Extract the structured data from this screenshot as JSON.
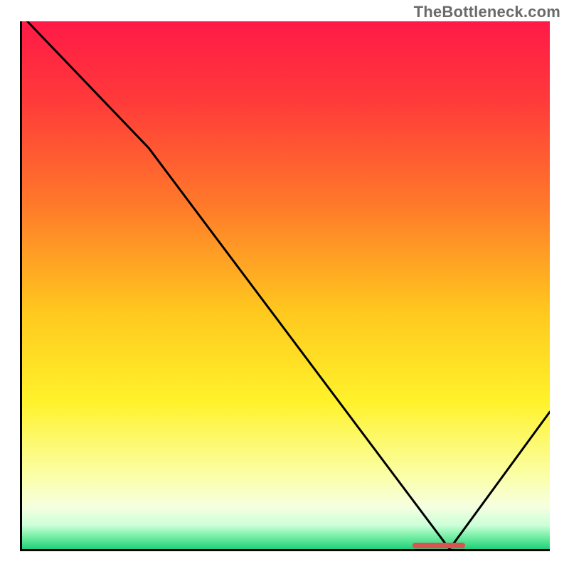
{
  "watermark": "TheBottleneck.com",
  "colors": {
    "axis": "#000000",
    "line": "#000000",
    "marker": "#d9534f",
    "gradient_stops": [
      {
        "offset": 0.0,
        "color": "#ff1a47"
      },
      {
        "offset": 0.15,
        "color": "#ff3a3a"
      },
      {
        "offset": 0.35,
        "color": "#ff7a2a"
      },
      {
        "offset": 0.55,
        "color": "#ffc81e"
      },
      {
        "offset": 0.72,
        "color": "#fff22a"
      },
      {
        "offset": 0.86,
        "color": "#fbffa6"
      },
      {
        "offset": 0.92,
        "color": "#f6ffe0"
      },
      {
        "offset": 0.955,
        "color": "#ccffd8"
      },
      {
        "offset": 0.975,
        "color": "#7af0a8"
      },
      {
        "offset": 1.0,
        "color": "#1fd07a"
      }
    ]
  },
  "chart_data": {
    "type": "line",
    "title": "",
    "xlabel": "",
    "ylabel": "",
    "xlim": [
      0,
      100
    ],
    "ylim": [
      0,
      100
    ],
    "x": [
      1,
      24,
      81,
      100
    ],
    "values": [
      100,
      76,
      0,
      26
    ],
    "marker": {
      "x_start": 74,
      "x_end": 84,
      "y": 0.5
    }
  }
}
